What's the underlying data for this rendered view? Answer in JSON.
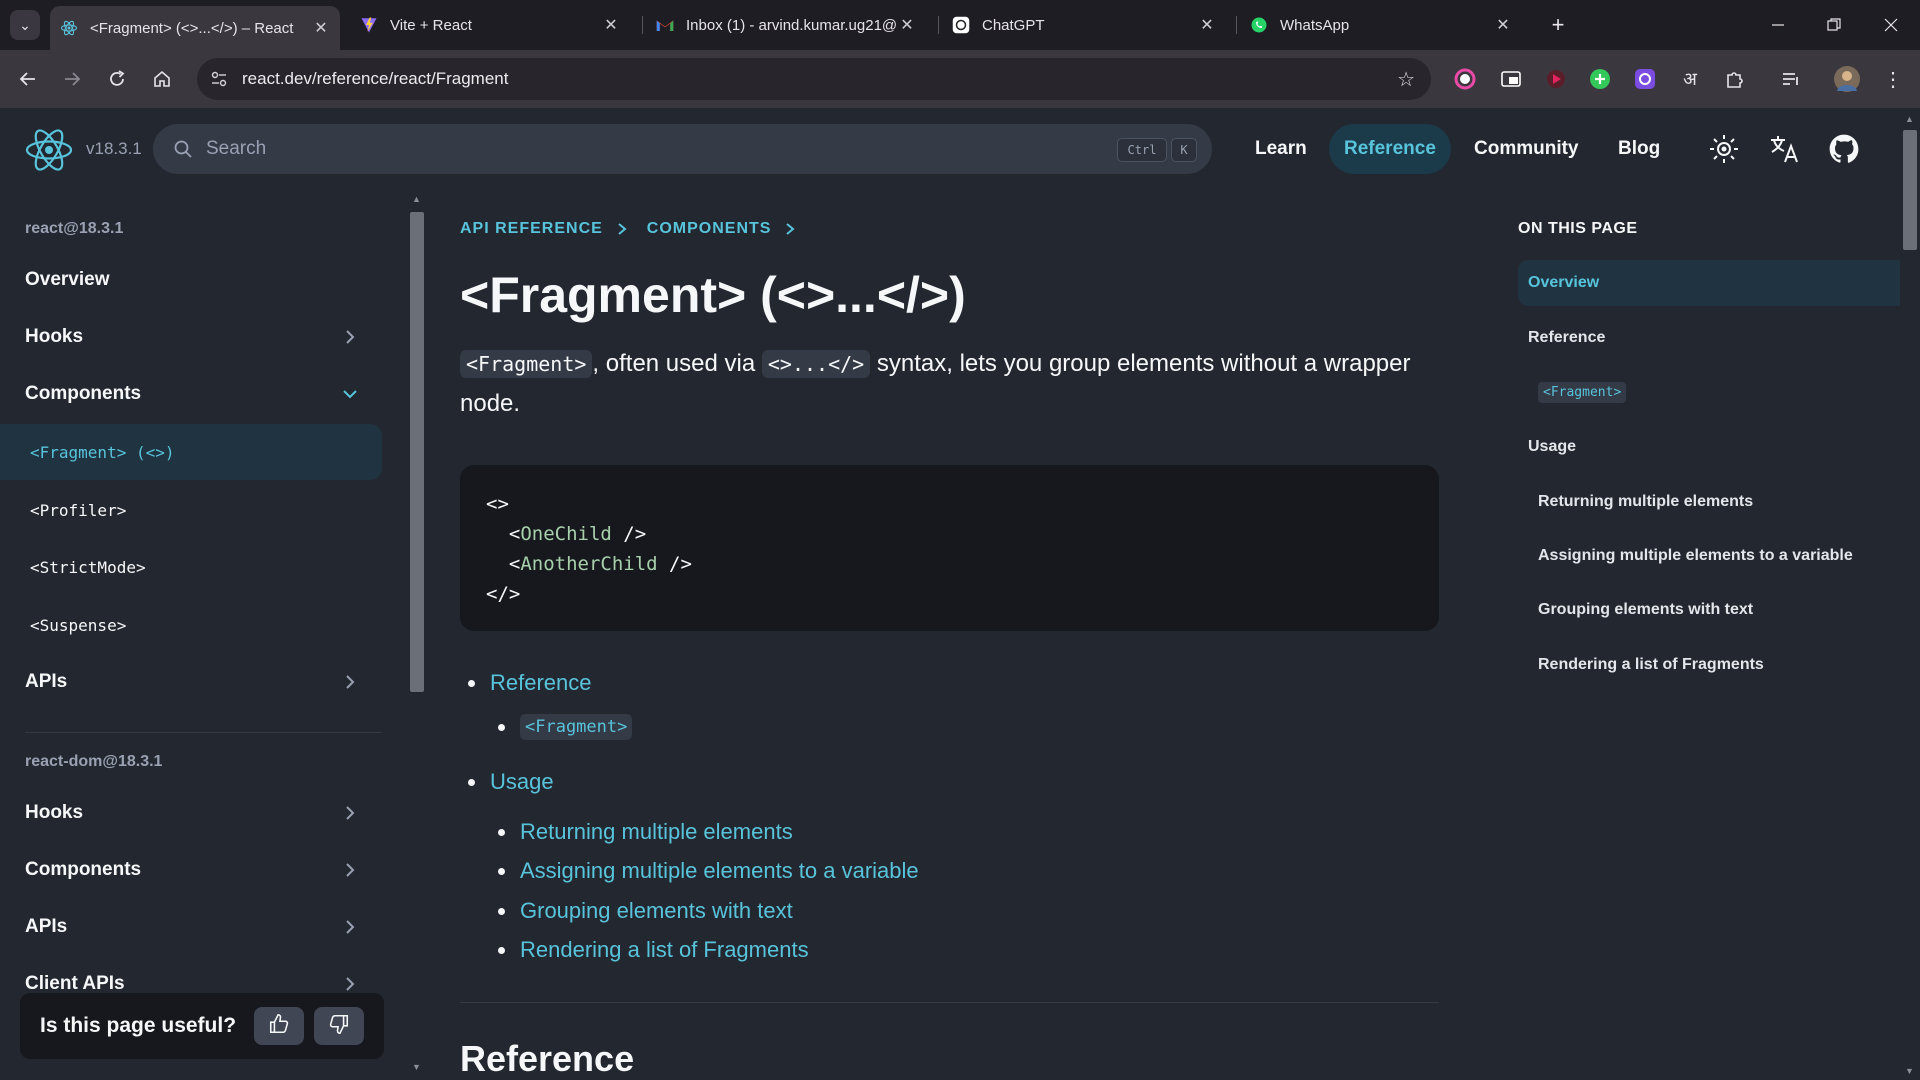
{
  "browser": {
    "tabs": [
      {
        "title": "<Fragment> (<>...</>) – React",
        "icon": "react-icon",
        "active": true
      },
      {
        "title": "Vite + React",
        "icon": "vite-icon",
        "active": false
      },
      {
        "title": "Inbox (1) - arvind.kumar.ug21@",
        "icon": "gmail-icon",
        "active": false
      },
      {
        "title": "ChatGPT",
        "icon": "chatgpt-icon",
        "active": false
      },
      {
        "title": "WhatsApp",
        "icon": "whatsapp-icon",
        "active": false
      }
    ],
    "url": "react.dev/reference/react/Fragment"
  },
  "site": {
    "version": "v18.3.1",
    "search_placeholder": "Search",
    "shortcut_ctrl": "Ctrl",
    "shortcut_key": "K",
    "nav": [
      {
        "label": "Learn",
        "active": false
      },
      {
        "label": "Reference",
        "active": true
      },
      {
        "label": "Community",
        "active": false
      },
      {
        "label": "Blog",
        "active": false
      }
    ]
  },
  "sidebar": {
    "section1": "react@18.3.1",
    "items1": [
      {
        "label": "Overview"
      },
      {
        "label": "Hooks"
      },
      {
        "label": "Components"
      }
    ],
    "subitems": [
      {
        "label": "<Fragment> (<>)",
        "active": true
      },
      {
        "label": "<Profiler>"
      },
      {
        "label": "<StrictMode>"
      },
      {
        "label": "<Suspense>"
      }
    ],
    "apis1": "APIs",
    "section2": "react-dom@18.3.1",
    "items2": [
      {
        "label": "Hooks"
      },
      {
        "label": "Components"
      },
      {
        "label": "APIs"
      },
      {
        "label": "Client APIs"
      }
    ],
    "feedback": "Is this page useful?"
  },
  "main": {
    "breadcrumb": [
      "API REFERENCE",
      "COMPONENTS"
    ],
    "title": "<Fragment> (<>...</>)",
    "intro_code1": "<Fragment>",
    "intro_text1": ", often used via ",
    "intro_code2": "<>...</>",
    "intro_text2": " syntax, lets you group elements without a wrapper node.",
    "code": {
      "l1": "<>",
      "l2_open": "  <",
      "l2_comp": "OneChild",
      "l2_close": " />",
      "l3_open": "  <",
      "l3_comp": "AnotherChild",
      "l3_close": " />",
      "l4": "</>"
    },
    "toc": {
      "reference": "Reference",
      "fragment": "<Fragment>",
      "usage": "Usage",
      "usage_items": [
        "Returning multiple elements",
        "Assigning multiple elements to a variable",
        "Grouping elements with text",
        "Rendering a list of Fragments"
      ]
    },
    "section_title": "Reference"
  },
  "on_this_page": {
    "heading": "ON THIS PAGE",
    "items": [
      {
        "label": "Overview",
        "active": true
      },
      {
        "label": "Reference"
      },
      {
        "label": "<Fragment>",
        "code": true
      },
      {
        "label": "Usage"
      },
      {
        "label": "Returning multiple elements"
      },
      {
        "label": "Assigning multiple elements to a variable"
      },
      {
        "label": "Grouping elements with text"
      },
      {
        "label": "Rendering a list of Fragments"
      }
    ]
  },
  "colors": {
    "accent": "#58c4dc",
    "background": "#23272f",
    "text": "#f6f7f9"
  }
}
